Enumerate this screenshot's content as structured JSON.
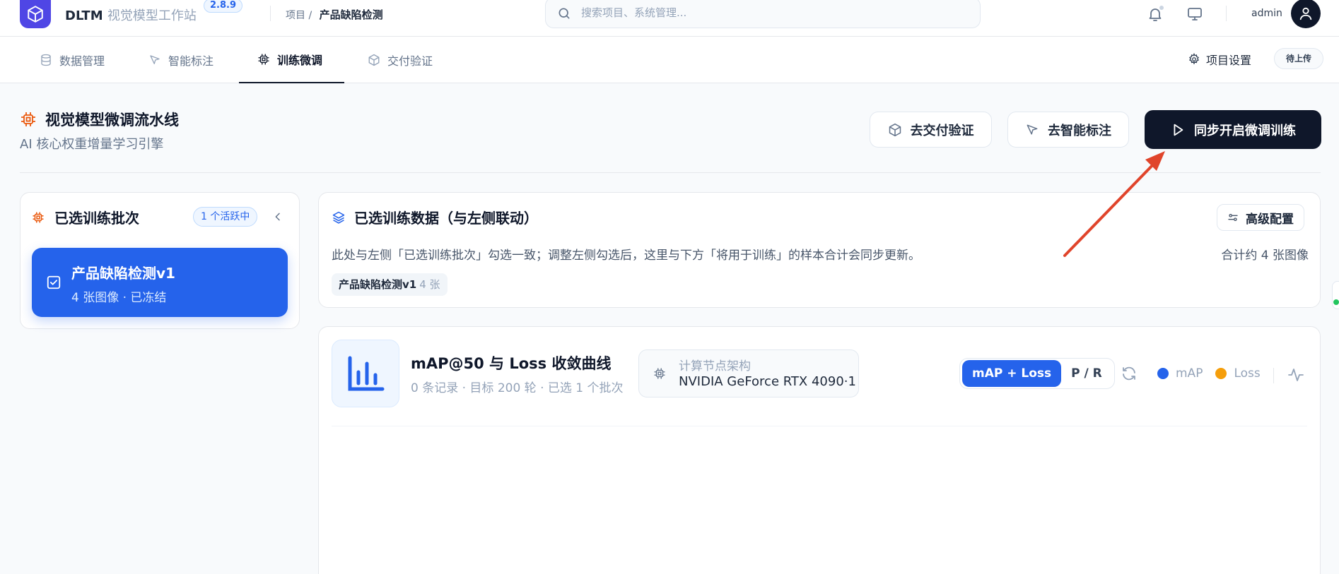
{
  "header": {
    "brand_name": "DLTM",
    "brand_sub": "视觉模型工作站",
    "version": "2.8.9",
    "breadcrumb_prefix": "项目 /",
    "breadcrumb_current": "产品缺陷检测",
    "search_placeholder": "搜索项目、系统管理...",
    "user_name": "admin"
  },
  "tabs": [
    {
      "label": "数据管理",
      "icon": "database-icon"
    },
    {
      "label": "智能标注",
      "icon": "cursor-icon"
    },
    {
      "label": "训练微调",
      "icon": "chip-icon",
      "active": true
    },
    {
      "label": "交付验证",
      "icon": "package-icon"
    }
  ],
  "tabbar_right": {
    "settings_label": "项目设置",
    "status_badge": "待上传"
  },
  "page": {
    "title": "视觉模型微调流水线",
    "subtitle": "AI 核心权重增量学习引擎",
    "btn_delivery": "去交付验证",
    "btn_annotate": "去智能标注",
    "btn_start": "同步开启微调训练"
  },
  "batches": {
    "title": "已选训练批次",
    "active_badge": "1 个活跃中",
    "items": [
      {
        "name": "产品缺陷检测v1",
        "meta": "4 张图像 · 已冻结",
        "checked": true
      }
    ]
  },
  "selected_data": {
    "title": "已选训练数据（与左侧联动）",
    "advanced_label": "高级配置",
    "description": "此处与左侧「已选训练批次」勾选一致；调整左侧勾选后，这里与下方「将用于训练」的样本合计会同步更新。",
    "total": "合计约 4 张图像",
    "chips": [
      {
        "name": "产品缺陷检测v1",
        "count": "4 张"
      }
    ]
  },
  "chart_panel": {
    "title": "mAP@50 与 Loss 收敛曲线",
    "meta": "0 条记录 · 目标 200 轮 · 已选 1 个批次",
    "node_label": "计算节点架构",
    "node_value": "NVIDIA GeForce RTX 4090·1",
    "modes": [
      "mAP + Loss",
      "P / R"
    ],
    "active_mode": "mAP + Loss",
    "legend": [
      {
        "name": "mAP",
        "color": "#2563eb"
      },
      {
        "name": "Loss",
        "color": "#f59e0b"
      }
    ]
  },
  "colors": {
    "accent": "#2563eb",
    "primary_dark": "#0f172a",
    "logo": "#4f46e5",
    "icon_orange": "#ea580c",
    "annotation_arrow": "#e0442b"
  }
}
